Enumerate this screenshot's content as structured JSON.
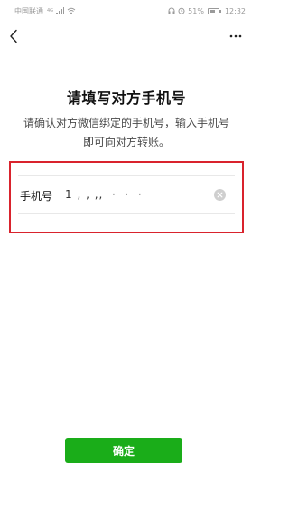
{
  "status_bar": {
    "carrier": "中国联通",
    "network": "4G",
    "battery": "51%",
    "battery_level": 0.51,
    "time": "12:32",
    "icons": [
      "signal-icon",
      "wifi-icon",
      "headset-icon",
      "alarm-icon",
      "battery-icon"
    ]
  },
  "nav": {
    "back_icon": "chevron-left-icon",
    "more_icon": "more-dots-icon"
  },
  "page": {
    "title": "请填写对方手机号",
    "subtitle_line1": "请确认对方微信绑定的手机号，输入手机号",
    "subtitle_line2": "即可向对方转账。"
  },
  "phone_field": {
    "label": "手机号",
    "value": "1 , , ,,  ·  ·  ·",
    "clear_icon": "clear-icon"
  },
  "actions": {
    "confirm_label": "确定"
  },
  "colors": {
    "accent_green": "#1aad19",
    "highlight_red": "#d9232d",
    "text_primary": "#111111",
    "text_secondary": "#4a4a4a"
  }
}
